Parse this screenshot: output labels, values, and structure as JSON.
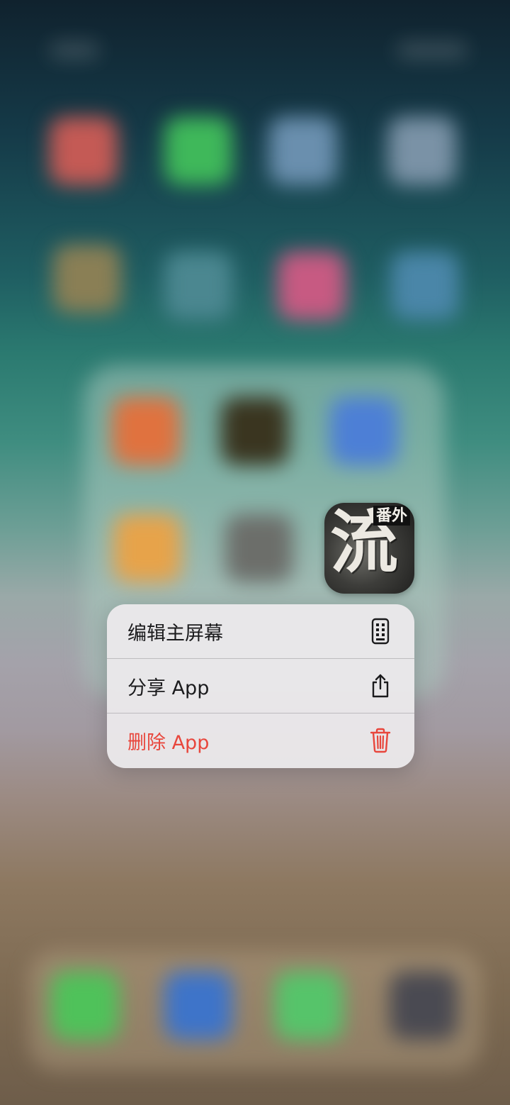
{
  "app": {
    "icon_text": "流",
    "icon_tag": "番外"
  },
  "context_menu": {
    "items": [
      {
        "label": "编辑主屏幕",
        "icon": "phone-grid-icon",
        "destructive": false
      },
      {
        "label": "分享 App",
        "icon": "share-icon",
        "destructive": false
      },
      {
        "label": "删除 App",
        "icon": "trash-icon",
        "destructive": true
      }
    ]
  },
  "colors": {
    "destructive": "#e8463c",
    "menu_text": "#1b1b1d",
    "menu_background": "#eceaec"
  }
}
